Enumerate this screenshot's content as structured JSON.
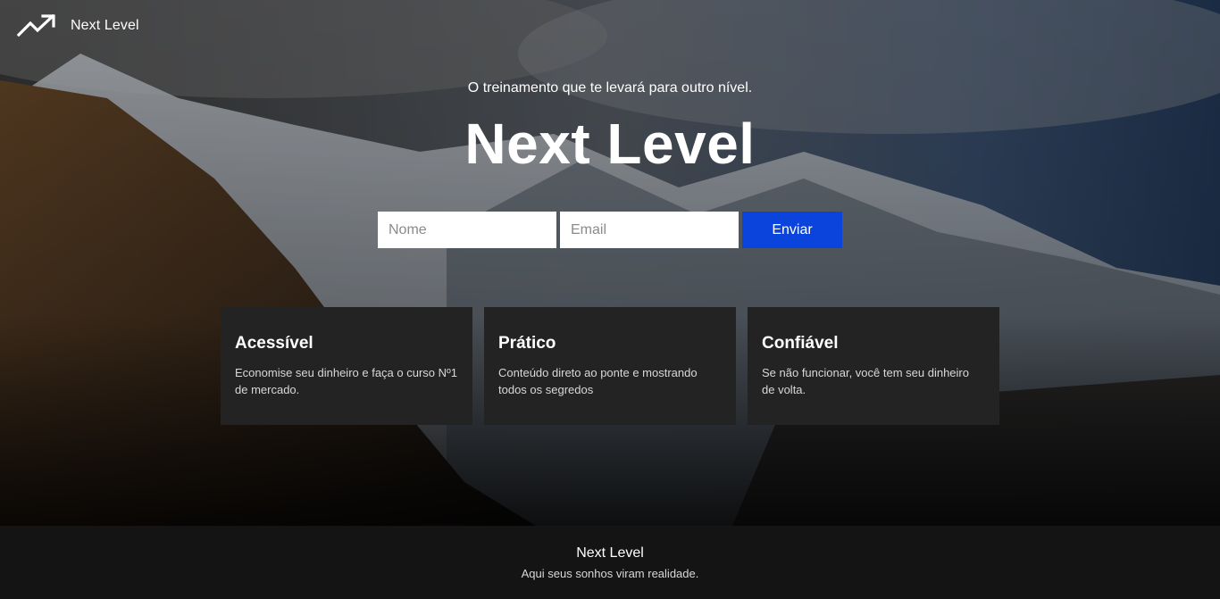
{
  "header": {
    "logo_icon": "trending-up-icon",
    "logo_text": "Next Level"
  },
  "hero": {
    "tagline": "O treinamento que te levará para outro nível.",
    "title": "Next Level",
    "background": "mountain-landscape-photo"
  },
  "form": {
    "name_placeholder": "Nome",
    "name_value": "",
    "email_placeholder": "Email",
    "email_value": "",
    "submit_label": "Enviar"
  },
  "features": [
    {
      "title": "Acessível",
      "text": "Economise seu dinheiro e faça o curso Nº1 de mercado."
    },
    {
      "title": "Prático",
      "text": "Conteúdo direto ao ponte e mostrando todos os segredos"
    },
    {
      "title": "Confiável",
      "text": "Se não funcionar, você tem seu dinheiro de volta."
    }
  ],
  "footer": {
    "title": "Next Level",
    "subtitle": "Aqui seus sonhos viram realidade."
  },
  "colors": {
    "accent": "#0a44dc",
    "card_background": "#232323",
    "footer_background": "#141414"
  }
}
